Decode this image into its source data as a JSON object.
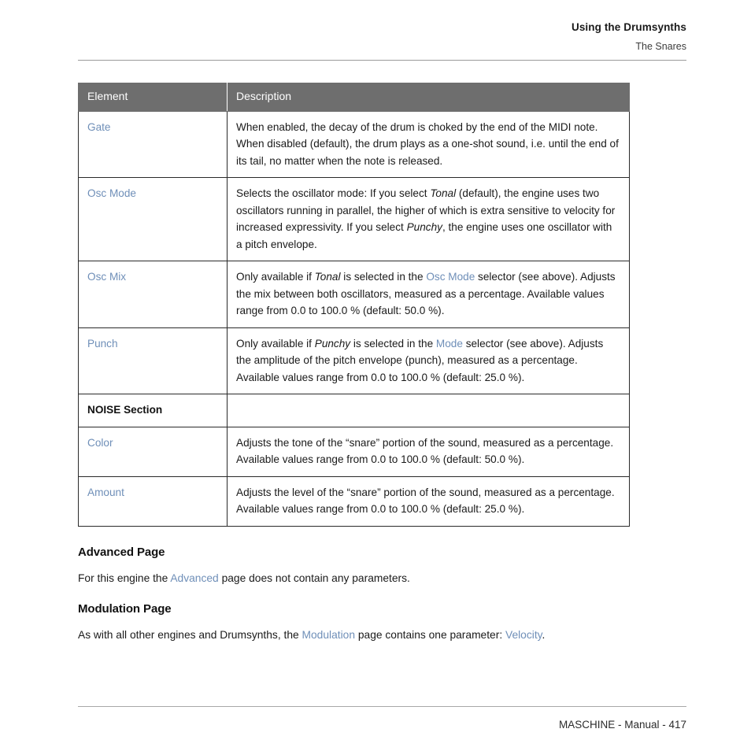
{
  "header": {
    "chapter": "Using the Drumsynths",
    "section": "The Snares"
  },
  "table": {
    "columns": [
      "Element",
      "Description"
    ],
    "rows": [
      {
        "type": "param",
        "element": "Gate",
        "description_html": "When enabled, the decay of the drum is choked by the end of the MIDI note. When disabled (default), the drum plays as a one-shot sound, i.e. until the end of its tail, no matter when the note is released.",
        "description_text": "When enabled, the decay of the drum is choked by the end of the MIDI note. When disabled (default), the drum plays as a one-shot sound, i.e. until the end of its tail, no matter when the note is released."
      },
      {
        "type": "param",
        "element": "Osc Mode",
        "description_html": "Selects the oscillator mode: If you select <i>Tonal</i> (default), the engine uses two oscillators running in parallel, the higher of which is extra sensitive to velocity for increased expressivity. If you select <i>Punchy</i>, the engine uses one oscillator with a pitch envelope.",
        "description_text": "Selects the oscillator mode: If you select Tonal (default), the engine uses two oscillators running in parallel, the higher of which is extra sensitive to velocity for increased expressivity. If you select Punchy, the engine uses one oscillator with a pitch envelope."
      },
      {
        "type": "param",
        "element": "Osc Mix",
        "description_html": "Only available if <i>Tonal</i> is selected in the <span class=\"lnk\">Osc Mode</span> selector (see above). Adjusts the mix between both oscillators, measured as a percentage. Available values range from 0.0 to 100.0 % (default: 50.0 %).",
        "description_text": "Only available if Tonal is selected in the Osc Mode selector (see above). Adjusts the mix between both oscillators, measured as a percentage. Available values range from 0.0 to 100.0 % (default: 50.0 %)."
      },
      {
        "type": "param",
        "element": "Punch",
        "description_html": "Only available if <i>Punchy</i> is selected in the <span class=\"lnk\">Mode</span> selector (see above). Adjusts the amplitude of the pitch envelope (punch), measured as a percentage. Available values range from 0.0 to 100.0 % (default: 25.0 %).",
        "description_text": "Only available if Punchy is selected in the Mode selector (see above). Adjusts the amplitude of the pitch envelope (punch), measured as a percentage. Available values range from 0.0 to 100.0 % (default: 25.0 %)."
      },
      {
        "type": "section",
        "element": "NOISE Section",
        "description_html": "",
        "description_text": ""
      },
      {
        "type": "param",
        "element": "Color",
        "description_html": "Adjusts the tone of the “snare” portion of the sound, measured as a percentage. Available values range from 0.0 to 100.0 % (default: 50.0 %).",
        "description_text": "Adjusts the tone of the “snare” portion of the sound, measured as a percentage. Available values range from 0.0 to 100.0 % (default: 50.0 %)."
      },
      {
        "type": "param",
        "element": "Amount",
        "description_html": "Adjusts the level of the “snare” portion of the sound, measured as a percentage. Available values range from 0.0 to 100.0 % (default: 25.0 %).",
        "description_text": "Adjusts the level of the “snare” portion of the sound, measured as a percentage. Available values range from 0.0 to 100.0 % (default: 25.0 %)."
      }
    ]
  },
  "sections": {
    "advanced": {
      "heading": "Advanced Page",
      "paragraph_html": "For this engine the <span class=\"lnk\">Advanced</span> page does not contain any parameters.",
      "paragraph_text": "For this engine the Advanced page does not contain any parameters."
    },
    "modulation": {
      "heading": "Modulation Page",
      "paragraph_html": "As with all other engines and Drumsynths, the <span class=\"lnk\">Modulation</span> page contains one parameter: <span class=\"lnk\">Velocity</span>.",
      "paragraph_text": "As with all other engines and Drumsynths, the Modulation page contains one parameter: Velocity."
    }
  },
  "footer": {
    "text": "MASCHINE - Manual - 417"
  },
  "colors": {
    "table_header_background": "#6e6e6e",
    "table_header_text": "#ffffff",
    "link": "#6f8fb8",
    "body_text": "#1a1a1a",
    "rule": "#9a9a9a"
  }
}
